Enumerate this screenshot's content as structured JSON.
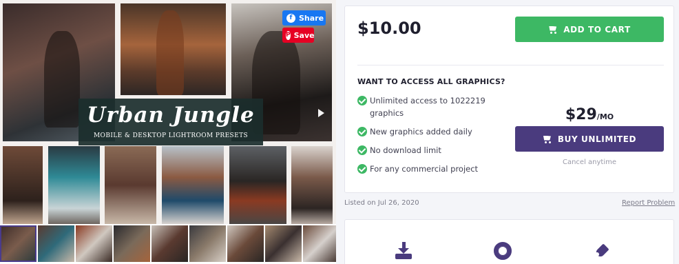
{
  "gallery": {
    "banner_title": "Urban Jungle",
    "banner_subtitle": "MOBILE & DESKTOP LIGHTROOM PRESETS",
    "share_label": "Share",
    "save_label": "Save",
    "thumbnail_count": 9
  },
  "purchase": {
    "price": "$10.00",
    "add_to_cart_label": "ADD TO CART",
    "access_title": "WANT TO ACCESS ALL GRAPHICS?",
    "features": [
      "Unlimited access to 1022219 graphics",
      "New graphics added daily",
      "No download limit",
      "For any commercial project"
    ],
    "unlimited_price": "$29",
    "unlimited_period": "/MO",
    "buy_unlimited_label": "BUY UNLIMITED",
    "cancel_text": "Cancel anytime"
  },
  "meta": {
    "listed_text": "Listed on Jul 26, 2020",
    "report_label": "Report Problem"
  },
  "colors": {
    "accent_green": "#3db864",
    "accent_purple": "#4a3b7e",
    "facebook_blue": "#1877f2",
    "pinterest_red": "#e60023"
  },
  "icons": [
    "download-icon",
    "lifebuoy-icon",
    "pen-nib-icon",
    "cart-icon",
    "check-circle-icon"
  ]
}
